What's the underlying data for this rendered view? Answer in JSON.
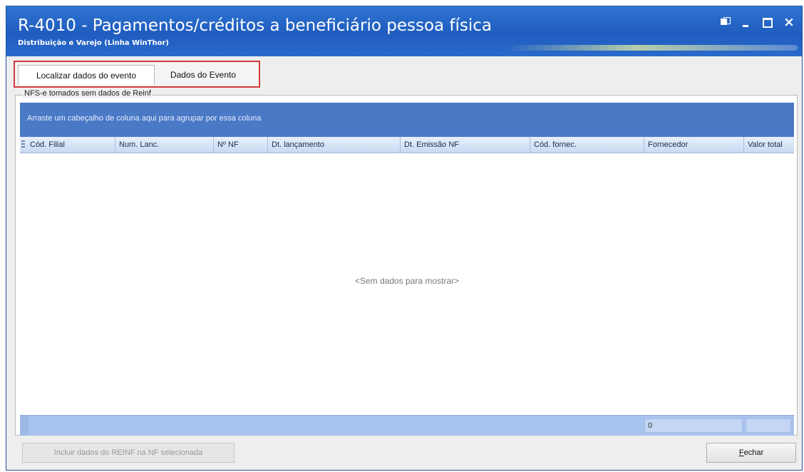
{
  "window": {
    "title": "R-4010 - Pagamentos/créditos a beneficiário pessoa física",
    "subtitle": "Distribuição e Varejo (Linha WinThor)",
    "controls": [
      "restore-icon",
      "minimize-icon",
      "maximize-icon",
      "close-icon"
    ]
  },
  "tabs": [
    {
      "label": "Localizar dados do evento",
      "active": true
    },
    {
      "label": "Dados do Evento",
      "active": false
    }
  ],
  "group": {
    "legend": "NFS-e tomados sem dados de Reinf",
    "group_panel_text": "Arraste um cabeçalho de coluna aqui para agrupar por essa coluna"
  },
  "grid": {
    "columns": [
      "Cód. Filial",
      "Num. Lanc.",
      "Nº NF",
      "Dt. lançamento",
      "Dt. Emissão NF",
      "Cód. fornec.",
      "Fornecedor",
      "Valor total"
    ],
    "empty_text": "<Sem dados para mostrar>",
    "footer_summary": "0"
  },
  "buttons": {
    "include": "Incluir dados do REINF na NF selecionada",
    "close_first": "F",
    "close_rest": "echar"
  },
  "colors": {
    "titlebar": "#1f5cbf",
    "group_panel": "#4a79c6",
    "tab_highlight": "#d33a3a"
  }
}
